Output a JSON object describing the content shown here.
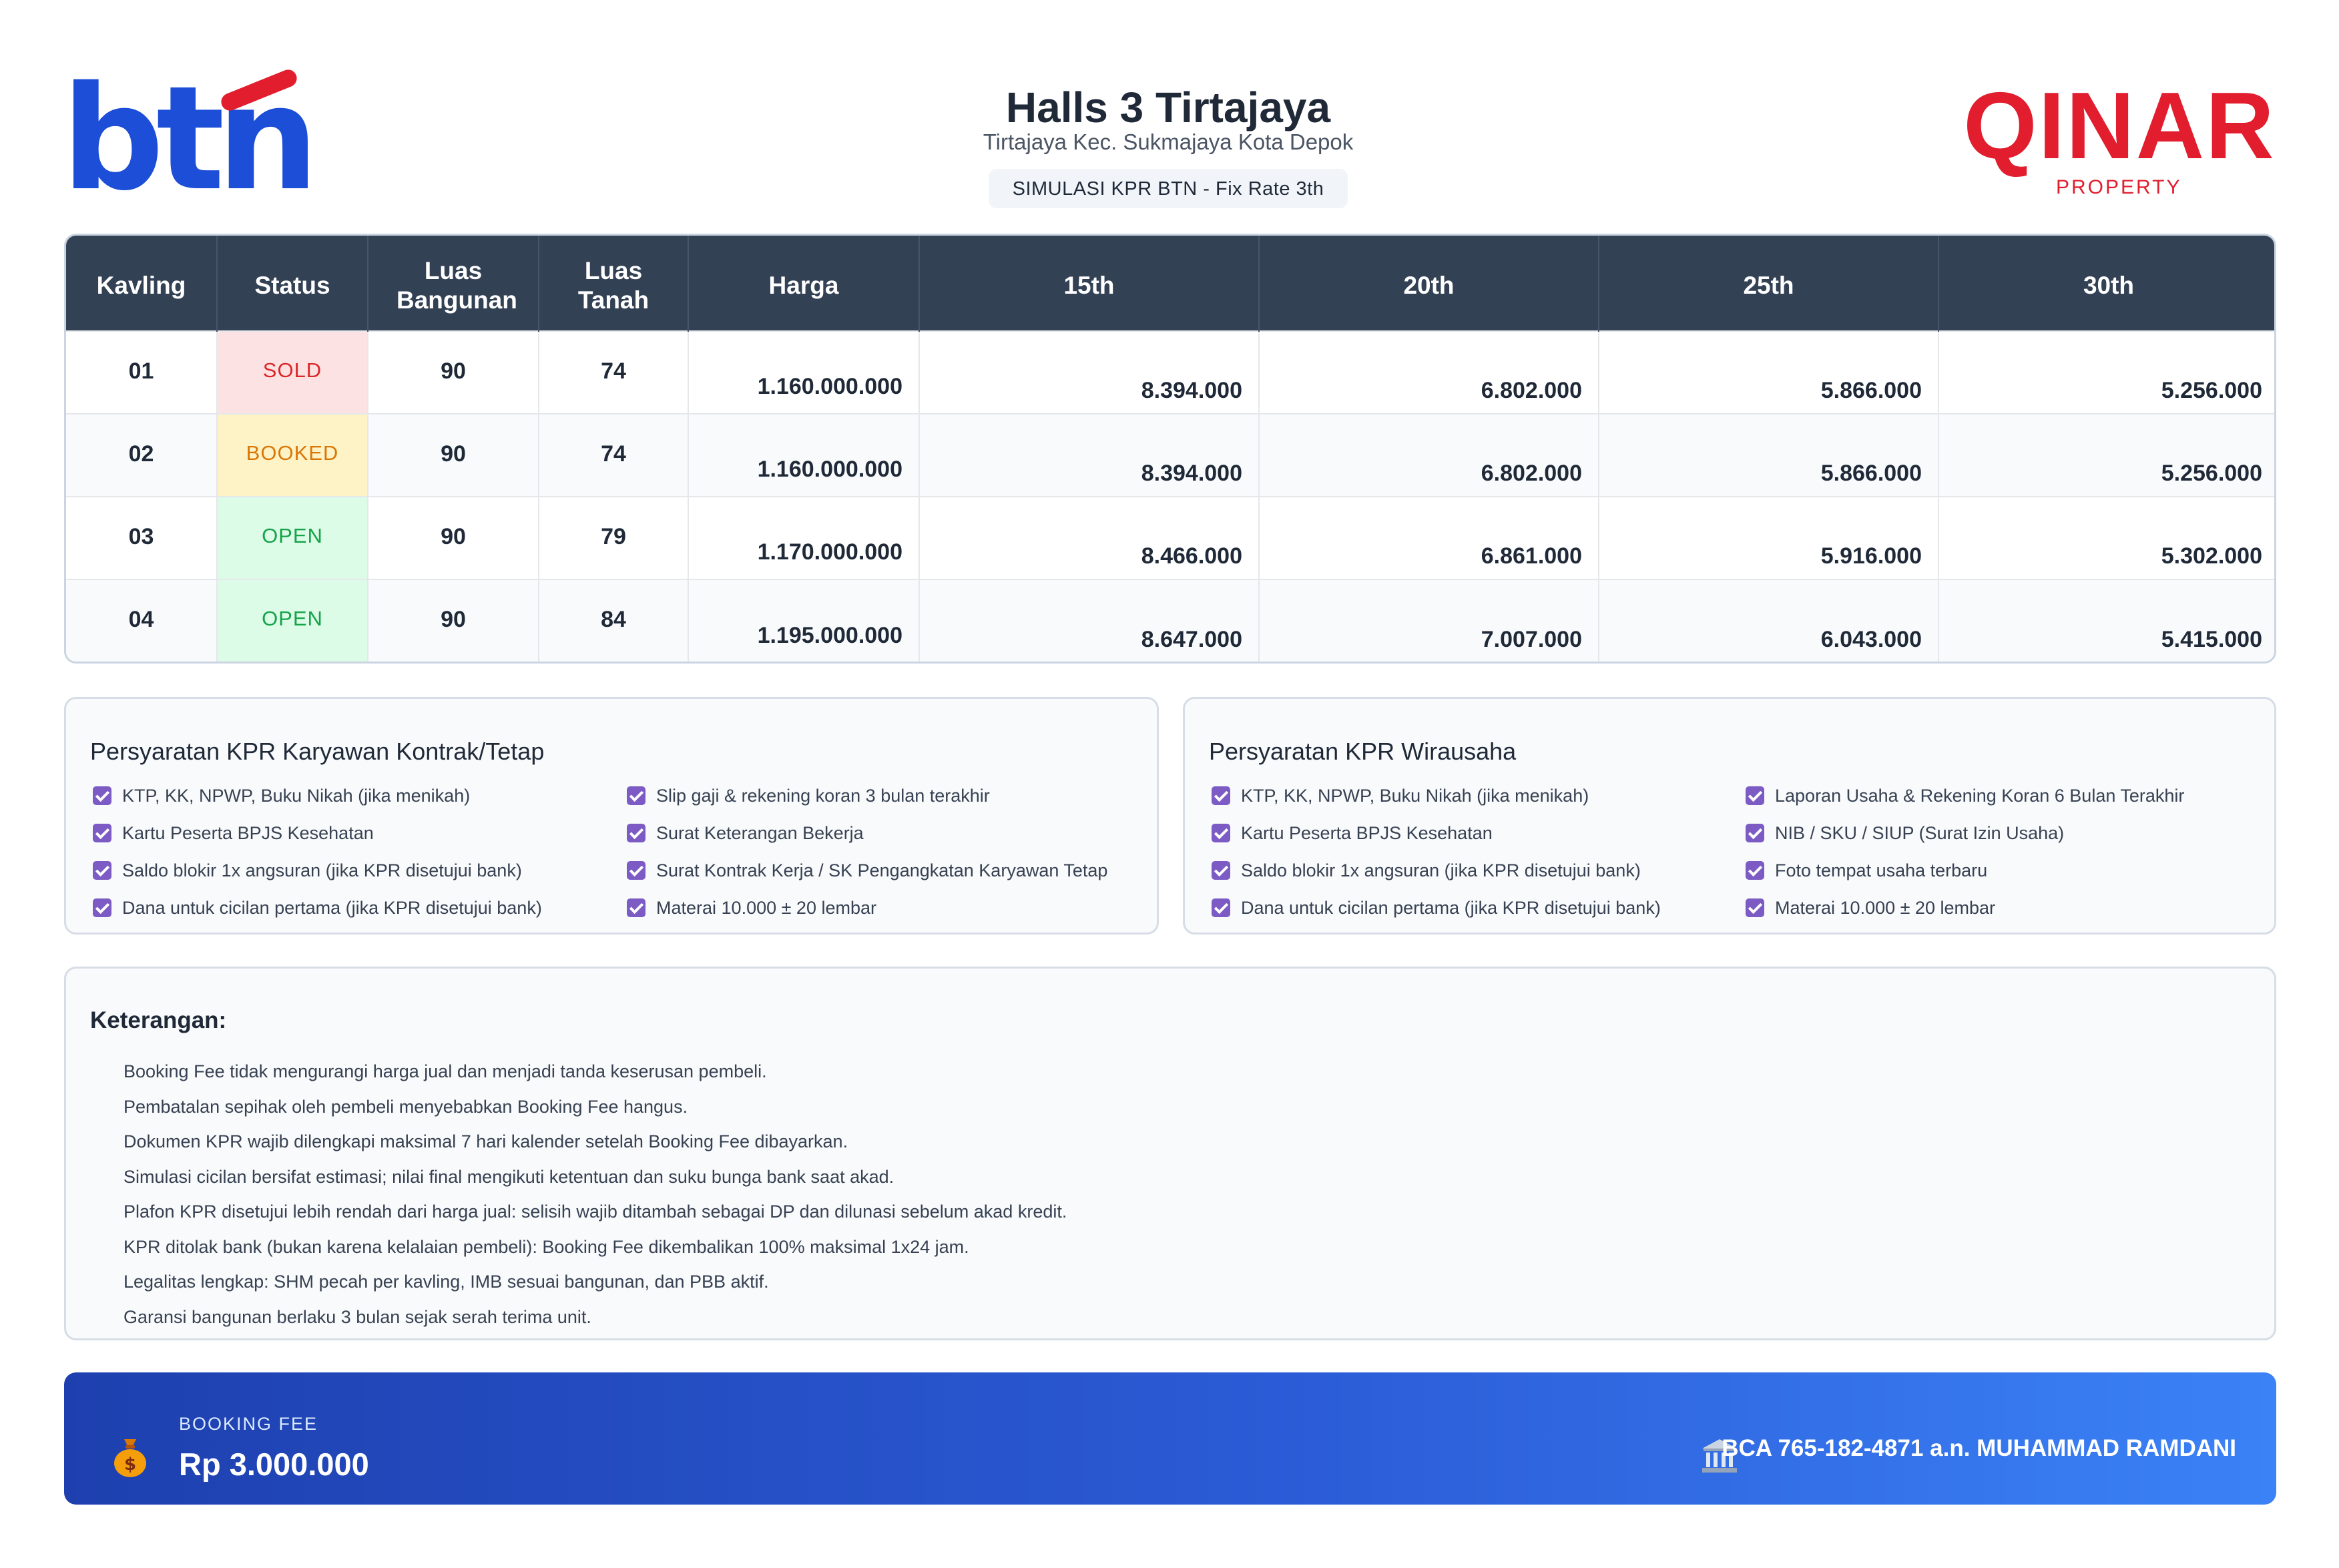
{
  "header": {
    "left_logo": "btn",
    "right_logo": "QINAR",
    "right_logo_sub": "PROPERTY",
    "title": "Halls 3 Tirtajaya",
    "subtitle": "Tirtajaya Kec. Sukmajaya Kota Depok",
    "simulation_badge": "SIMULASI KPR BTN - Fix Rate 3th"
  },
  "table": {
    "headers": [
      "Kavling",
      "Status",
      "Luas Bangunan",
      "Luas Tanah",
      "Harga",
      "15th",
      "20th",
      "25th",
      "30th"
    ],
    "rows": [
      {
        "kavling": "01",
        "status": "SOLD",
        "bangunan": "90",
        "tanah": "74",
        "harga": "1.160.000.000",
        "t15": "8.394.000",
        "t20": "6.802.000",
        "t25": "5.866.000",
        "t30": "5.256.000"
      },
      {
        "kavling": "02",
        "status": "BOOKED",
        "bangunan": "90",
        "tanah": "74",
        "harga": "1.160.000.000",
        "t15": "8.394.000",
        "t20": "6.802.000",
        "t25": "5.866.000",
        "t30": "5.256.000"
      },
      {
        "kavling": "03",
        "status": "OPEN",
        "bangunan": "90",
        "tanah": "79",
        "harga": "1.170.000.000",
        "t15": "8.466.000",
        "t20": "6.861.000",
        "t25": "5.916.000",
        "t30": "5.302.000"
      },
      {
        "kavling": "04",
        "status": "OPEN",
        "bangunan": "90",
        "tanah": "84",
        "harga": "1.195.000.000",
        "t15": "8.647.000",
        "t20": "7.007.000",
        "t25": "6.043.000",
        "t30": "5.415.000"
      }
    ],
    "status_colors": {
      "SOLD": "#dc2626",
      "BOOKED": "#d97706",
      "OPEN": "#16a34a"
    }
  },
  "req_karyawan": {
    "title": "Persyaratan KPR Karyawan Kontrak/Tetap",
    "items": [
      "KTP, KK, NPWP, Buku Nikah (jika menikah)",
      "Slip gaji & rekening koran 3 bulan terakhir",
      "Kartu Peserta BPJS Kesehatan",
      "Surat Keterangan Bekerja",
      "Saldo blokir 1x angsuran (jika KPR disetujui bank)",
      "Surat Kontrak Kerja / SK Pengangkatan Karyawan Tetap",
      "Dana untuk cicilan pertama (jika KPR disetujui bank)",
      "Materai 10.000 ± 20 lembar"
    ]
  },
  "req_wirausaha": {
    "title": "Persyaratan KPR Wirausaha",
    "items": [
      "KTP, KK, NPWP, Buku Nikah (jika menikah)",
      "Laporan Usaha & Rekening Koran 6 Bulan Terakhir",
      "Kartu Peserta BPJS Kesehatan",
      "NIB / SKU / SIUP (Surat Izin Usaha)",
      "Saldo blokir 1x angsuran (jika KPR disetujui bank)",
      "Foto tempat usaha terbaru",
      "Dana untuk cicilan pertama (jika KPR disetujui bank)",
      "Materai 10.000 ± 20 lembar"
    ]
  },
  "keterangan": {
    "title": "Keterangan:",
    "items": [
      "Booking Fee tidak mengurangi harga jual dan menjadi tanda keserusan pembeli.",
      "Pembatalan sepihak oleh pembeli menyebabkan Booking Fee hangus.",
      "Dokumen KPR wajib dilengkapi maksimal 7 hari kalender setelah Booking Fee dibayarkan.",
      "Simulasi cicilan bersifat estimasi; nilai final mengikuti ketentuan dan suku bunga bank saat akad.",
      "Plafon KPR disetujui lebih rendah dari harga jual: selisih wajib ditambah sebagai DP dan dilunasi sebelum akad kredit.",
      "KPR ditolak bank (bukan karena kelalaian pembeli): Booking Fee dikembalikan 100% maksimal 1x24 jam.",
      "Legalitas lengkap: SHM pecah per kavling, IMB sesuai bangunan, dan PBB aktif.",
      "Garansi bangunan berlaku 3 bulan sejak serah terima unit."
    ]
  },
  "booking": {
    "label": "BOOKING FEE",
    "value": "Rp 3.000.000",
    "bank": "BCA 765-182-4871 a.n. MUHAMMAD RAMDANI",
    "icons": [
      "money-bag-icon",
      "bank-icon"
    ]
  },
  "colors": {
    "header_row": "#334155",
    "accent_blue": "#1d4ed8",
    "brand_red": "#e11d2e",
    "check_purple": "#7c5cc4"
  }
}
